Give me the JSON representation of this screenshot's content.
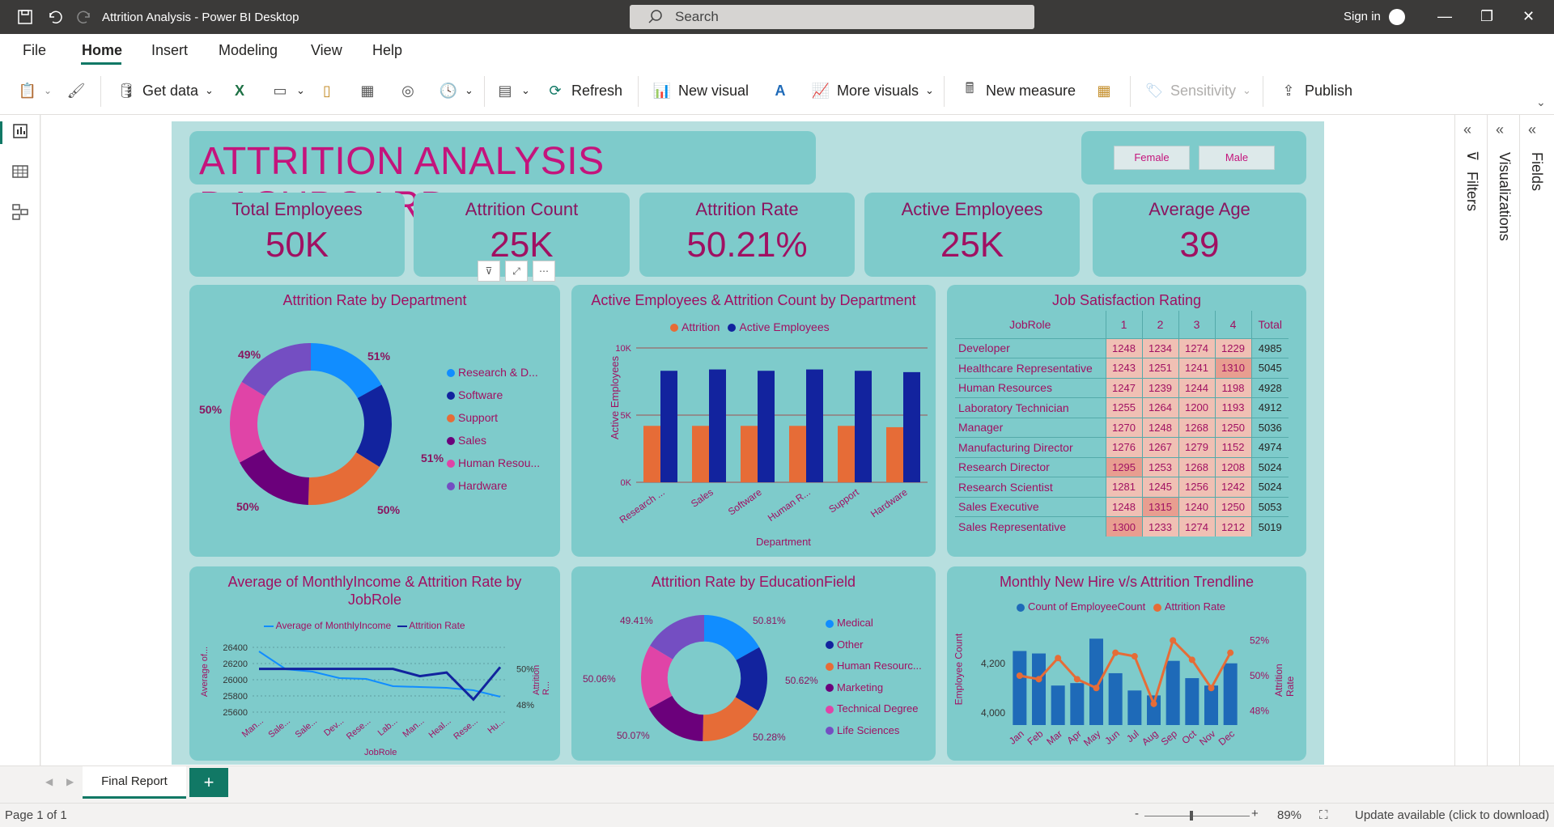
{
  "window": {
    "title": "Attrition Analysis - Power BI Desktop",
    "search_placeholder": "Search",
    "sign_in": "Sign in"
  },
  "menu": {
    "file": "File",
    "home": "Home",
    "insert": "Insert",
    "modeling": "Modeling",
    "view": "View",
    "help": "Help"
  },
  "ribbon": {
    "get_data": "Get data",
    "refresh": "Refresh",
    "new_visual": "New visual",
    "more_visuals": "More visuals",
    "new_measure": "New measure",
    "sensitivity": "Sensitivity",
    "publish": "Publish"
  },
  "dashboard": {
    "title": "ATTRITION ANALYSIS DASHBOARD",
    "slicer": {
      "female": "Female",
      "male": "Male"
    },
    "kpis": [
      {
        "label": "Total Employees",
        "value": "50K"
      },
      {
        "label": "Attrition Count",
        "value": "25K"
      },
      {
        "label": "Attrition Rate",
        "value": "50.21%"
      },
      {
        "label": "Active Employees",
        "value": "25K"
      },
      {
        "label": "Average Age",
        "value": "39"
      }
    ]
  },
  "chart_data": [
    {
      "type": "pie",
      "title": "Attrition Rate by Department",
      "categories": [
        "Research & D...",
        "Software",
        "Support",
        "Sales",
        "Human Resou...",
        "Hardware"
      ],
      "values": [
        51,
        51,
        50,
        50,
        50,
        49
      ],
      "labels": [
        "51%",
        "51%",
        "50%",
        "50%",
        "50%",
        "49%"
      ],
      "colors": [
        "#118dff",
        "#12239e",
        "#e66c37",
        "#6b007b",
        "#e044a7",
        "#744ec2"
      ]
    },
    {
      "type": "bar",
      "title": "Active Employees & Attrition Count by Department",
      "categories": [
        "Research ...",
        "Sales",
        "Software",
        "Human R...",
        "Support",
        "Hardware"
      ],
      "series": [
        {
          "name": "Attrition",
          "values": [
            4200,
            4200,
            4200,
            4200,
            4200,
            4100
          ],
          "color": "#e66c37"
        },
        {
          "name": "Active Employees",
          "values": [
            8300,
            8400,
            8300,
            8400,
            8300,
            8200
          ],
          "color": "#12239e"
        }
      ],
      "xlabel": "Department",
      "ylabel": "Active Employees",
      "yticks": [
        "0K",
        "5K",
        "10K"
      ],
      "ylim": [
        0,
        10000
      ]
    },
    {
      "type": "table",
      "title": "Job Satisfaction Rating",
      "columns": [
        "JobRole",
        "1",
        "2",
        "3",
        "4",
        "Total"
      ],
      "rows": [
        [
          "Developer",
          "1248",
          "1234",
          "1274",
          "1229",
          "4985"
        ],
        [
          "Healthcare Representative",
          "1243",
          "1251",
          "1241",
          "1310",
          "5045"
        ],
        [
          "Human Resources",
          "1247",
          "1239",
          "1244",
          "1198",
          "4928"
        ],
        [
          "Laboratory Technician",
          "1255",
          "1264",
          "1200",
          "1193",
          "4912"
        ],
        [
          "Manager",
          "1270",
          "1248",
          "1268",
          "1250",
          "5036"
        ],
        [
          "Manufacturing Director",
          "1276",
          "1267",
          "1279",
          "1152",
          "4974"
        ],
        [
          "Research Director",
          "1295",
          "1253",
          "1268",
          "1208",
          "5024"
        ],
        [
          "Research Scientist",
          "1281",
          "1245",
          "1256",
          "1242",
          "5024"
        ],
        [
          "Sales Executive",
          "1248",
          "1315",
          "1240",
          "1250",
          "5053"
        ],
        [
          "Sales Representative",
          "1300",
          "1233",
          "1274",
          "1212",
          "5019"
        ]
      ]
    },
    {
      "type": "line",
      "title": "Average of MonthlyIncome & Attrition Rate by JobRole",
      "categories": [
        "Man...",
        "Sale...",
        "Sale...",
        "Dev...",
        "Rese...",
        "Lab...",
        "Man...",
        "Heal...",
        "Rese...",
        "Hu..."
      ],
      "series": [
        {
          "name": "Average of MonthlyIncome",
          "values": [
            26350,
            26130,
            26100,
            26020,
            26010,
            25920,
            25910,
            25900,
            25870,
            25790
          ],
          "color": "#118dff"
        },
        {
          "name": "Attrition Rate",
          "values": [
            50.0,
            50.0,
            50.0,
            50.0,
            50.0,
            50.0,
            49.6,
            49.8,
            48.3,
            50.1
          ],
          "color": "#12239e"
        }
      ],
      "xlabel": "JobRole",
      "ylabel": "Average of...",
      "y2label": "Attrition R...",
      "yticks": [
        "25600",
        "25800",
        "26000",
        "26200",
        "26400"
      ],
      "y2ticks": [
        "48%",
        "50%"
      ]
    },
    {
      "type": "pie",
      "title": "Attrition Rate by EducationField",
      "categories": [
        "Medical",
        "Other",
        "Human Resourc...",
        "Marketing",
        "Technical Degree",
        "Life Sciences"
      ],
      "values": [
        50.81,
        50.62,
        50.28,
        50.07,
        50.06,
        49.41
      ],
      "labels": [
        "50.81%",
        "50.62%",
        "50.28%",
        "50.07%",
        "50.06%",
        "49.41%"
      ],
      "colors": [
        "#118dff",
        "#12239e",
        "#e66c37",
        "#6b007b",
        "#e044a7",
        "#744ec2"
      ]
    },
    {
      "type": "bar",
      "title": "Monthly New Hire v/s Attrition Trendline",
      "categories": [
        "Jan",
        "Feb",
        "Mar",
        "Apr",
        "May",
        "Jun",
        "Jul",
        "Aug",
        "Sep",
        "Oct",
        "Nov",
        "Dec"
      ],
      "series": [
        {
          "name": "Count of EmployeeCount",
          "values": [
            4250,
            4240,
            4110,
            4120,
            4300,
            4160,
            4090,
            4070,
            4210,
            4140,
            4110,
            4200
          ],
          "color": "#1e6ab8"
        },
        {
          "name": "Attrition Rate",
          "values": [
            50.0,
            49.8,
            51.0,
            49.8,
            49.3,
            51.3,
            51.1,
            48.4,
            52.0,
            50.9,
            49.3,
            51.3
          ],
          "color": "#e66c37"
        }
      ],
      "ylabel": "Employee Count",
      "y2label": "Attrition Rate",
      "yticks": [
        "4,000",
        "4,200"
      ],
      "y2ticks": [
        "48%",
        "50%",
        "52%"
      ]
    }
  ],
  "tabs": {
    "page": "Final Report",
    "add": "+"
  },
  "status": {
    "page": "Page 1 of 1",
    "zoom": "89%",
    "update": "Update available (click to download)"
  }
}
